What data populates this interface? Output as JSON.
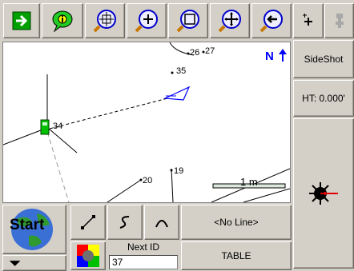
{
  "toolbar": {
    "exit_icon": "green-arrow-right-icon",
    "info_icon": "green-info-bubble-icon",
    "zoom_extents_icon": "zoom-extents-icon",
    "zoom_in_icon": "zoom-in-icon",
    "zoom_window_icon": "zoom-window-icon",
    "zoom_all_icon": "zoom-all-icon",
    "zoom_previous_icon": "zoom-previous-icon"
  },
  "right_panel": {
    "add_point_icon": "add-point-icon",
    "rod_icon": "rod-icon",
    "sideshot_label": "SideShot",
    "height_label": "HT: 0.000'",
    "target_icon": "laser-target-icon"
  },
  "map": {
    "north_label": "N",
    "points": [
      {
        "id": "26"
      },
      {
        "id": "27"
      },
      {
        "id": "35"
      },
      {
        "id": "34"
      },
      {
        "id": "20"
      },
      {
        "id": "19"
      }
    ],
    "scale_label": "1 m"
  },
  "bottom": {
    "start_label": "Start",
    "line_icon": "straight-line-icon",
    "spline_icon": "spline-curve-icon",
    "arc_icon": "arc-icon",
    "no_line_label": "<No Line>",
    "next_id_label": "Next ID",
    "next_id_value": "37",
    "table_label": "TABLE",
    "color_icon": "color-palette-icon",
    "dropdown_icon": "dropdown-arrow-icon"
  },
  "colors": {
    "toolbar_green": "#00a000",
    "map_blue": "#0000ff",
    "selected_green": "#00c000"
  }
}
